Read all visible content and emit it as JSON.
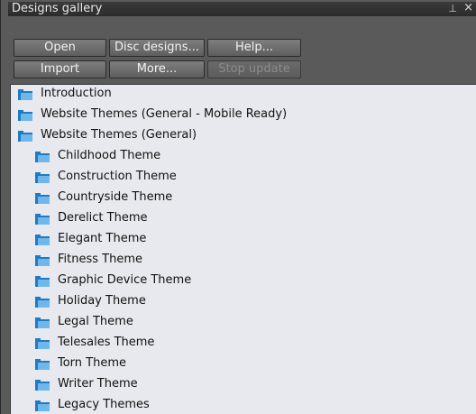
{
  "window": {
    "title": "Designs gallery",
    "pin_glyph": "⊥",
    "close_glyph": "×"
  },
  "toolbar": {
    "row1": [
      {
        "label": "Open",
        "enabled": true
      },
      {
        "label": "Disc designs...",
        "enabled": true
      },
      {
        "label": "Help...",
        "enabled": true
      }
    ],
    "row2": [
      {
        "label": "Import",
        "enabled": true
      },
      {
        "label": "More...",
        "enabled": true
      },
      {
        "label": "Stop update",
        "enabled": false
      }
    ]
  },
  "tree": {
    "items": [
      {
        "label": "Introduction",
        "level": 0
      },
      {
        "label": "Website Themes (General - Mobile Ready)",
        "level": 0
      },
      {
        "label": "Website Themes (General)",
        "level": 0
      },
      {
        "label": "Childhood Theme",
        "level": 1
      },
      {
        "label": "Construction Theme",
        "level": 1
      },
      {
        "label": "Countryside Theme",
        "level": 1
      },
      {
        "label": "Derelict Theme",
        "level": 1
      },
      {
        "label": "Elegant Theme",
        "level": 1
      },
      {
        "label": "Fitness Theme",
        "level": 1
      },
      {
        "label": "Graphic Device Theme",
        "level": 1
      },
      {
        "label": "Holiday Theme",
        "level": 1
      },
      {
        "label": "Legal Theme",
        "level": 1
      },
      {
        "label": "Telesales Theme",
        "level": 1
      },
      {
        "label": "Torn Theme",
        "level": 1
      },
      {
        "label": "Writer Theme",
        "level": 1
      },
      {
        "label": "Legacy Themes",
        "level": 1
      }
    ]
  },
  "colors": {
    "folder_blue": "#1f7bc4",
    "folder_light": "#6fb6ea",
    "list_background": "#e7e9ee",
    "panel_background": "#5a5a5a"
  }
}
